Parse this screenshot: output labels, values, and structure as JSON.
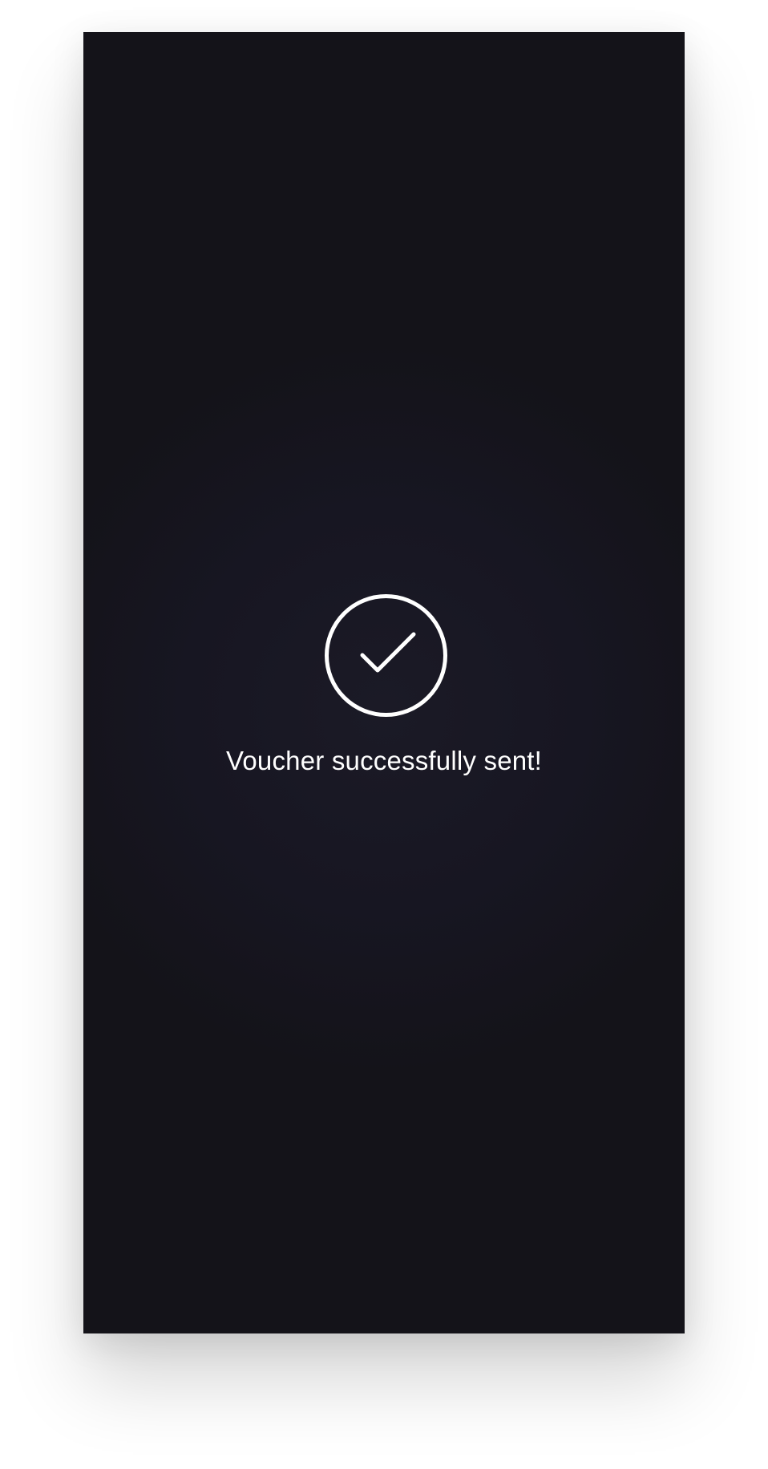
{
  "success_screen": {
    "icon": "check-circle-icon",
    "message": "Voucher successfully sent!"
  },
  "colors": {
    "background": "#171622",
    "foreground": "#ffffff"
  }
}
